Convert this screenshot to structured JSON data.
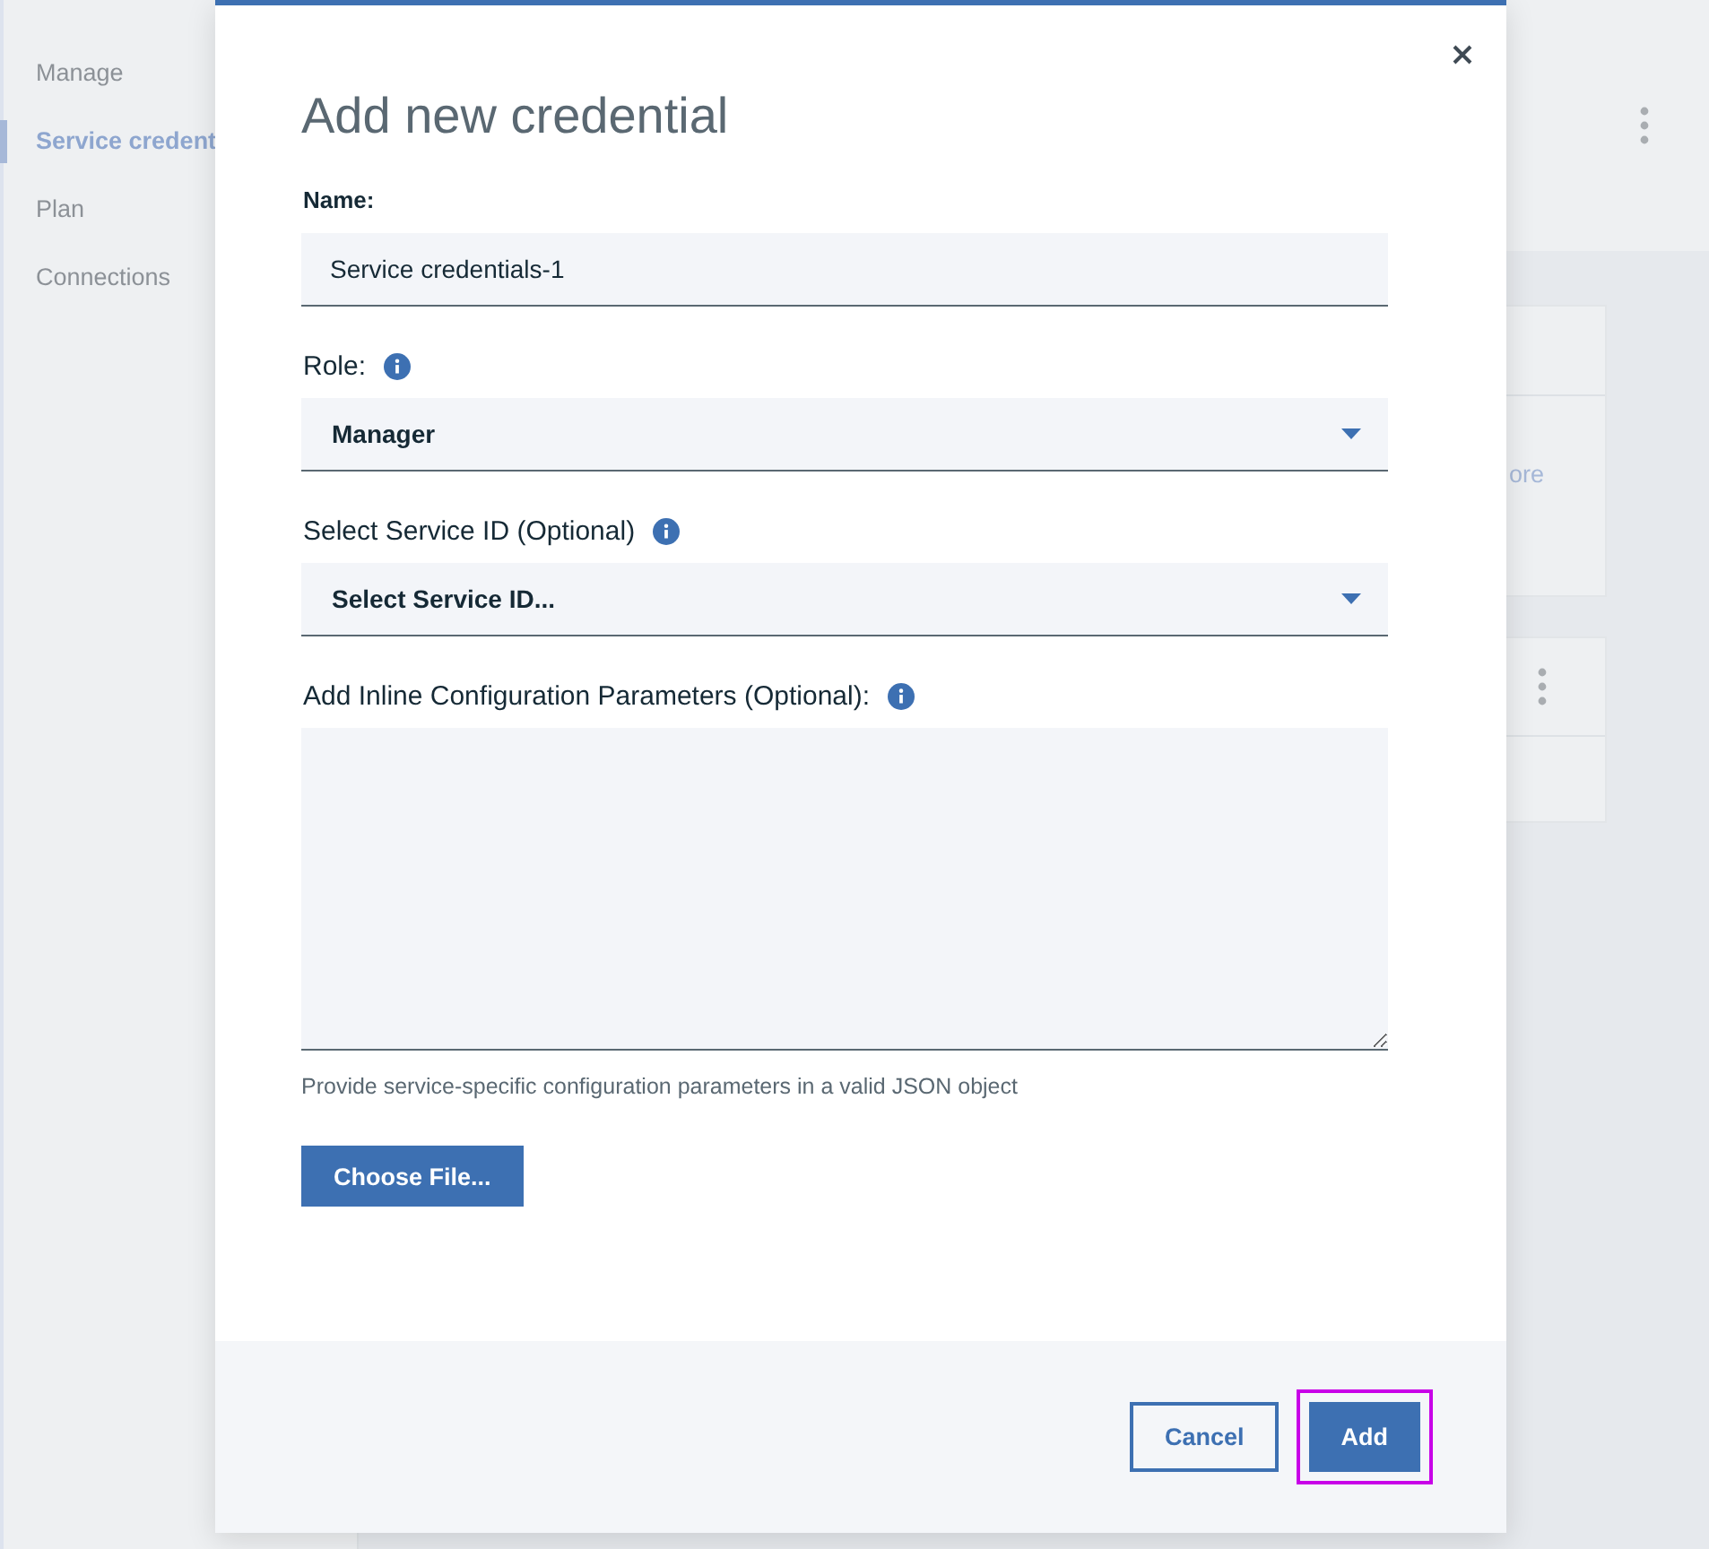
{
  "sidebar": {
    "items": [
      {
        "label": "Manage",
        "selected": false
      },
      {
        "label": "Service credent",
        "selected": true
      },
      {
        "label": "Plan",
        "selected": false
      },
      {
        "label": "Connections",
        "selected": false
      }
    ]
  },
  "background": {
    "card_text": "ore"
  },
  "dialog": {
    "title": "Add new credential",
    "fields": [
      {
        "kind": "text",
        "label": "Name:",
        "info": false,
        "value": "Service credentials-1"
      },
      {
        "kind": "select",
        "label": "Role:",
        "info": true,
        "value": "Manager"
      },
      {
        "kind": "select",
        "label": "Select Service ID (Optional)",
        "info": true,
        "value": "Select Service ID..."
      },
      {
        "kind": "textarea",
        "label": "Add Inline Configuration Parameters (Optional):",
        "info": true
      }
    ],
    "help_text": "Provide service-specific configuration parameters in a valid JSON object",
    "file_button": "Choose File...",
    "buttons": [
      {
        "label": "Cancel",
        "kind": "secondary",
        "focused": false
      },
      {
        "label": "Add",
        "kind": "primary",
        "focused": true
      }
    ]
  }
}
